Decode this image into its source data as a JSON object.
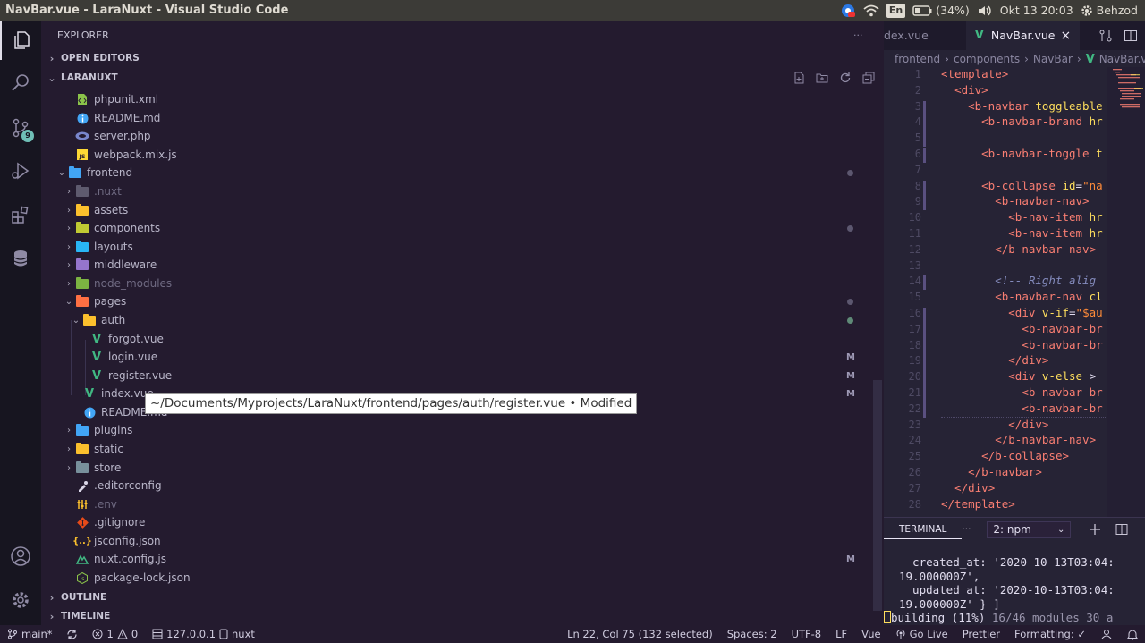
{
  "window": {
    "title": "NavBar.vue - LaraNuxt - Visual Studio Code"
  },
  "tray": {
    "lang": "En",
    "battery": "(34%)",
    "clock": "Okt 13 20:03",
    "user": "Behzod"
  },
  "activity": {
    "scm_badge": "9"
  },
  "sidebar": {
    "header": "EXPLORER",
    "more": "···",
    "open_editors": "OPEN EDITORS",
    "project": "LARANUXT",
    "outline": "OUTLINE",
    "timeline": "TIMELINE"
  },
  "tree": [
    {
      "label": "phpunit.xml"
    },
    {
      "label": "README.md"
    },
    {
      "label": "server.php"
    },
    {
      "label": "webpack.mix.js"
    },
    {
      "label": "frontend"
    },
    {
      "label": ".nuxt"
    },
    {
      "label": "assets"
    },
    {
      "label": "components"
    },
    {
      "label": "layouts"
    },
    {
      "label": "middleware"
    },
    {
      "label": "node_modules"
    },
    {
      "label": "pages"
    },
    {
      "label": "auth"
    },
    {
      "label": "forgot.vue"
    },
    {
      "label": "login.vue",
      "decoration": "M"
    },
    {
      "label": "register.vue",
      "decoration": "M"
    },
    {
      "label": "index.vue",
      "decoration": "M"
    },
    {
      "label": "README.md"
    },
    {
      "label": "plugins"
    },
    {
      "label": "static"
    },
    {
      "label": "store"
    },
    {
      "label": ".editorconfig"
    },
    {
      "label": ".env"
    },
    {
      "label": ".gitignore"
    },
    {
      "label": "jsconfig.json"
    },
    {
      "label": "nuxt.config.js",
      "decoration": "M"
    },
    {
      "label": "package-lock.json"
    }
  ],
  "tooltip": "~/Documents/Myprojects/LaraNuxt/frontend/pages/auth/register.vue • Modified",
  "tabs": [
    {
      "label": "dex.vue"
    },
    {
      "label": "NavBar.vue",
      "close": "×"
    }
  ],
  "breadcrumb": [
    "frontend",
    "components",
    "NavBar",
    "NavBar.vu"
  ],
  "code": {
    "line_numbers": [
      "1",
      "2",
      "3",
      "4",
      "5",
      "6",
      "7",
      "8",
      "9",
      "10",
      "11",
      "12",
      "13",
      "14",
      "15",
      "16",
      "17",
      "18",
      "19",
      "20",
      "21",
      "22",
      "23",
      "24",
      "25",
      "26",
      "27",
      "28"
    ],
    "lines": [
      [
        {
          "t": "tg",
          "v": "<template>"
        }
      ],
      [
        {
          "t": "pn",
          "v": "  "
        },
        {
          "t": "tg",
          "v": "<div>"
        }
      ],
      [
        {
          "t": "pn",
          "v": "    "
        },
        {
          "t": "tg",
          "v": "<b-navbar"
        },
        {
          "t": "at",
          "v": " toggleable"
        }
      ],
      [
        {
          "t": "pn",
          "v": "      "
        },
        {
          "t": "tg",
          "v": "<b-navbar-brand"
        },
        {
          "t": "at",
          "v": " hr"
        }
      ],
      [],
      [
        {
          "t": "pn",
          "v": "      "
        },
        {
          "t": "tg",
          "v": "<b-navbar-toggle"
        },
        {
          "t": "at",
          "v": " t"
        }
      ],
      [],
      [
        {
          "t": "pn",
          "v": "      "
        },
        {
          "t": "tg",
          "v": "<b-collapse"
        },
        {
          "t": "at",
          "v": " id"
        },
        {
          "t": "pn",
          "v": "="
        },
        {
          "t": "st",
          "v": "\"na"
        }
      ],
      [
        {
          "t": "pn",
          "v": "        "
        },
        {
          "t": "tg",
          "v": "<b-navbar-nav>"
        }
      ],
      [
        {
          "t": "pn",
          "v": "          "
        },
        {
          "t": "tg",
          "v": "<b-nav-item"
        },
        {
          "t": "at",
          "v": " hr"
        }
      ],
      [
        {
          "t": "pn",
          "v": "          "
        },
        {
          "t": "tg",
          "v": "<b-nav-item"
        },
        {
          "t": "at",
          "v": " hr"
        }
      ],
      [
        {
          "t": "pn",
          "v": "        "
        },
        {
          "t": "tg",
          "v": "</b-navbar-nav>"
        }
      ],
      [],
      [
        {
          "t": "pn",
          "v": "        "
        },
        {
          "t": "cm",
          "v": "<!-- Right alig"
        }
      ],
      [
        {
          "t": "pn",
          "v": "        "
        },
        {
          "t": "tg",
          "v": "<b-navbar-nav"
        },
        {
          "t": "at",
          "v": " cl"
        }
      ],
      [
        {
          "t": "pn",
          "v": "          "
        },
        {
          "t": "tg",
          "v": "<div"
        },
        {
          "t": "at",
          "v": " v-if"
        },
        {
          "t": "pn",
          "v": "="
        },
        {
          "t": "st",
          "v": "\"$au"
        }
      ],
      [
        {
          "t": "pn",
          "v": "            "
        },
        {
          "t": "tg",
          "v": "<b-navbar-br"
        }
      ],
      [
        {
          "t": "pn",
          "v": "            "
        },
        {
          "t": "tg",
          "v": "<b-navbar-br"
        }
      ],
      [
        {
          "t": "pn",
          "v": "          "
        },
        {
          "t": "tg",
          "v": "</div>"
        }
      ],
      [
        {
          "t": "pn",
          "v": "          "
        },
        {
          "t": "tg",
          "v": "<div"
        },
        {
          "t": "at",
          "v": " v-else"
        },
        {
          "t": "pn",
          "v": " >"
        }
      ],
      [
        {
          "t": "pn",
          "v": "            "
        },
        {
          "t": "tg",
          "v": "<b-navbar-br"
        }
      ],
      [
        {
          "t": "pn",
          "v": "            "
        },
        {
          "t": "tg",
          "v": "<b-navbar-br"
        }
      ],
      [
        {
          "t": "pn",
          "v": "          "
        },
        {
          "t": "tg",
          "v": "</div>"
        }
      ],
      [
        {
          "t": "pn",
          "v": "        "
        },
        {
          "t": "tg",
          "v": "</b-navbar-nav>"
        }
      ],
      [
        {
          "t": "pn",
          "v": "      "
        },
        {
          "t": "tg",
          "v": "</b-collapse>"
        }
      ],
      [
        {
          "t": "pn",
          "v": "    "
        },
        {
          "t": "tg",
          "v": "</b-navbar>"
        }
      ],
      [
        {
          "t": "pn",
          "v": "  "
        },
        {
          "t": "tg",
          "v": "</div>"
        }
      ],
      [
        {
          "t": "tg",
          "v": "</template>"
        }
      ]
    ]
  },
  "panel": {
    "tab": "TERMINAL",
    "more": "···",
    "terminal_select": "2: npm",
    "terminal_lines": [
      "  created_at: '2020-10-13T03:04:",
      "19.000000Z',",
      "  updated_at: '2020-10-13T03:04:",
      "19.000000Z' } ]"
    ],
    "building": "building (11%)",
    "building_rest": " 16/46 modules 30 a"
  },
  "status": {
    "branch": "main*",
    "problems_errors": "1",
    "problems_warnings": "0",
    "host": "127.0.0.1",
    "task": "nuxt",
    "cursor": "Ln 22, Col 75 (132 selected)",
    "spaces": "Spaces: 2",
    "encoding": "UTF-8",
    "eol": "LF",
    "language": "Vue",
    "golive": "Go Live",
    "prettier": "Prettier",
    "formatting": "Formatting: ✓"
  },
  "colors": {
    "accent": "#f97e72",
    "attr": "#fede5d",
    "string": "#ff8b39",
    "comment": "#848bbd",
    "vue": "#41b883"
  }
}
